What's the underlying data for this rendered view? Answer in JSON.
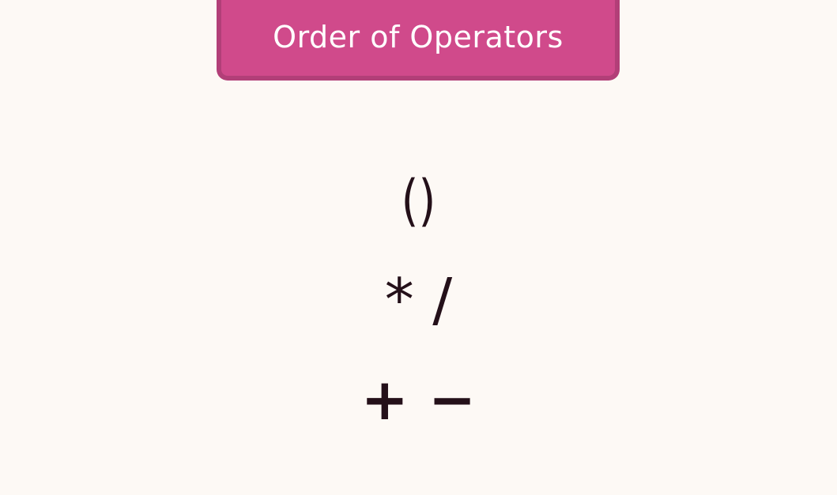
{
  "banner": {
    "title": "Order of Operators"
  },
  "operators": {
    "rows": [
      "()",
      "* /",
      "+ −"
    ]
  }
}
